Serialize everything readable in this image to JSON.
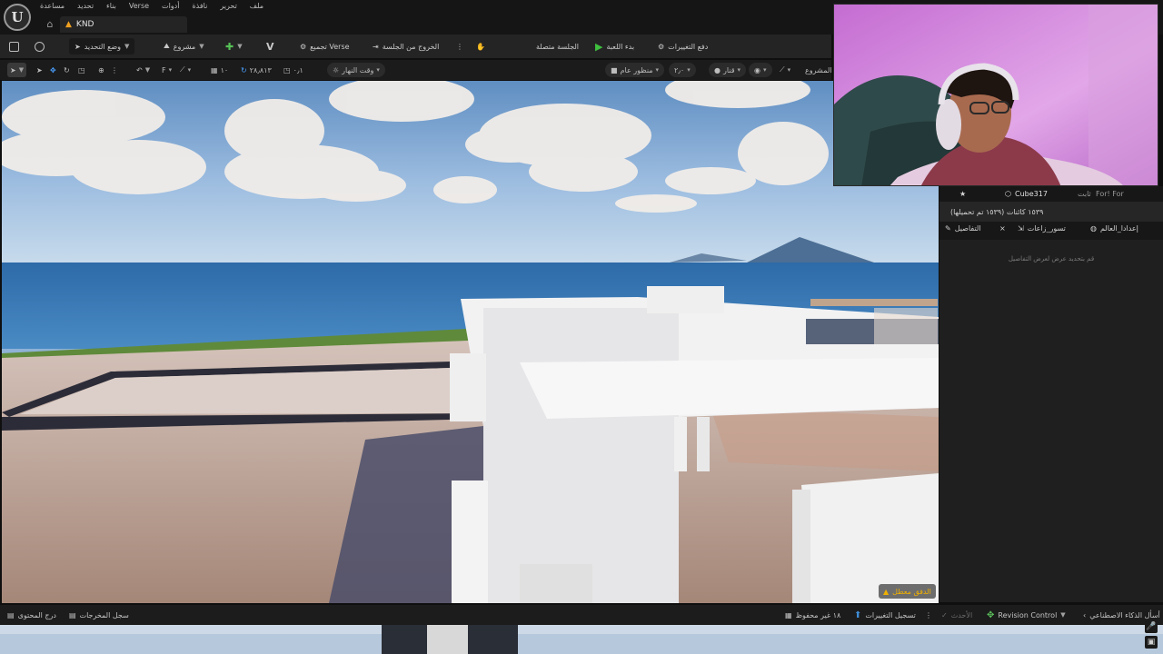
{
  "menubar": {
    "items": [
      "ملف",
      "تحرير",
      "نافذة",
      "أدوات",
      "Verse",
      "بناء",
      "تحديد",
      "مساعدة"
    ]
  },
  "tab": {
    "label": "KND"
  },
  "toolbar": {
    "select_mode": "وضع التحديد",
    "project": "مشروع",
    "verse_build": "تجميع Verse",
    "exit_session": "الخروج من الجلسة",
    "session_status": "الجلسة متصلة",
    "start_game": "بدء اللعبة",
    "push_changes": "دفع التغييرات"
  },
  "viewport_toolbar": {
    "snap_value": "١٠",
    "rotation_value": "٢٨٫٨١٣",
    "scale_value": "٠٫١",
    "time_of_day": "وقت النهار",
    "perspective": "منظور عام",
    "fov": "٢٫٠",
    "lit": "قنار",
    "project_label": "المشروع"
  },
  "viewport": {
    "performance_warning": "الدفق معطل"
  },
  "outliner": {
    "header_filter": "For! For",
    "header_type": "ثابت",
    "selected_item": "Cube317",
    "actor_count": "١٥٣٩ كائنات (١٥٣٩ تم تحميلها)"
  },
  "details_tabs": {
    "details": "التفاصيل",
    "world_partition": "تسور_زاعات",
    "world_settings": "إعدادا_العالم",
    "empty_message": "قم بتحديد عرض لعرض التفاصيل"
  },
  "statusbar": {
    "content_drawer": "درج المحتوى",
    "output_log": "سجل المخرجات",
    "unsaved": "١٨ غير محفوظ",
    "submit_changes": "تسجيل التغييرات",
    "latest": "الأحدث",
    "revision_control": "Revision Control",
    "ai_assistant": "أسأل الذكاء الاصطناعي"
  },
  "colors": {
    "accent_green": "#3fbf3f",
    "warning_orange": "#f0a020",
    "panel_bg": "#1f1f1f",
    "toolbar_bg": "#242424"
  }
}
